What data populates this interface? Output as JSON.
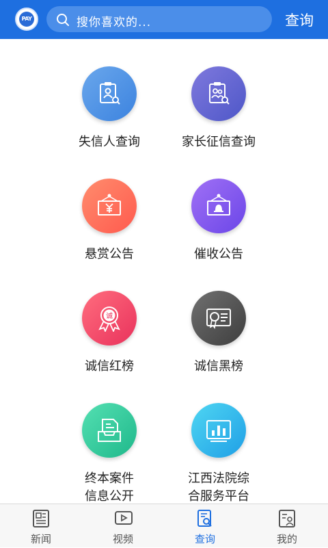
{
  "header": {
    "logo_text": "PAY",
    "search_placeholder": "搜你喜欢的...",
    "query_label": "查询"
  },
  "menu": [
    {
      "label": "失信人查询",
      "icon": "id-badge-search-icon",
      "color_from": "#6aa7ec",
      "color_to": "#3c83df"
    },
    {
      "label": "家长征信查询",
      "icon": "family-badge-search-icon",
      "color_from": "#7f79dd",
      "color_to": "#4e57c8"
    },
    {
      "label": "悬赏公告",
      "icon": "yuan-sign-board-icon",
      "color_from": "#ff8c6d",
      "color_to": "#ff5a4e"
    },
    {
      "label": "催收公告",
      "icon": "bell-sign-board-icon",
      "color_from": "#a070f5",
      "color_to": "#6b46e8"
    },
    {
      "label": "诚信红榜",
      "icon": "honor-medal-icon",
      "color_from": "#ff6d7e",
      "color_to": "#e9325c"
    },
    {
      "label": "诚信黑榜",
      "icon": "certificate-seal-icon",
      "color_from": "#707070",
      "color_to": "#3e3e3e"
    },
    {
      "label_line1": "终本案件",
      "label_line2": "信息公开",
      "icon": "inbox-document-icon",
      "color_from": "#54e0b2",
      "color_to": "#1fb88b"
    },
    {
      "label_line1": "江西法院综",
      "label_line2": "合服务平台",
      "icon": "bar-chart-board-icon",
      "color_from": "#4fd6f2",
      "color_to": "#1f9fe6"
    }
  ],
  "tabs": [
    {
      "label": "新闻",
      "icon": "newspaper-icon"
    },
    {
      "label": "视频",
      "icon": "video-play-icon"
    },
    {
      "label": "查询",
      "icon": "document-search-icon"
    },
    {
      "label": "我的",
      "icon": "profile-card-icon"
    }
  ],
  "active_tab": "查询",
  "colors": {
    "primary": "#1e6fe0",
    "text": "#222222",
    "tab_inactive": "#555555"
  }
}
